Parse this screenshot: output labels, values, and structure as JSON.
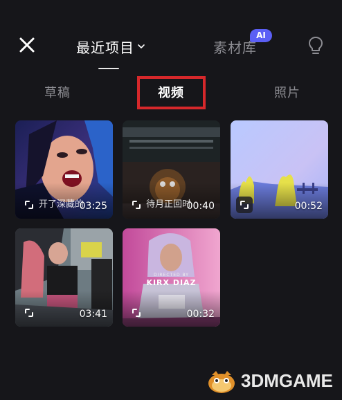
{
  "header": {
    "close_icon": "close-icon",
    "tab_recent": "最近项目",
    "tab_material": "素材库",
    "ai_badge": "AI",
    "bulb_icon": "lightbulb-icon"
  },
  "subtabs": {
    "drafts": "草稿",
    "video": "视频",
    "photo": "照片",
    "selected": "视频"
  },
  "media": [
    {
      "duration": "03:25",
      "subtitle": "开了深藏的",
      "kind": "video"
    },
    {
      "duration": "00:40",
      "subtitle": "待月正回时",
      "kind": "video"
    },
    {
      "duration": "00:52",
      "subtitle": "",
      "kind": "video"
    },
    {
      "duration": "03:41",
      "subtitle": "",
      "kind": "video"
    },
    {
      "duration": "00:32",
      "subtitle": "",
      "kind": "video",
      "credit": "DIRECTED BY",
      "credit_name": "KIRX DIAZ"
    }
  ],
  "watermark": {
    "text": "3DMGAME"
  },
  "colors": {
    "background": "#16161a",
    "highlight": "#d6282b",
    "ai_badge": "#5b5ff5",
    "inactive_text": "#8d8d93"
  }
}
